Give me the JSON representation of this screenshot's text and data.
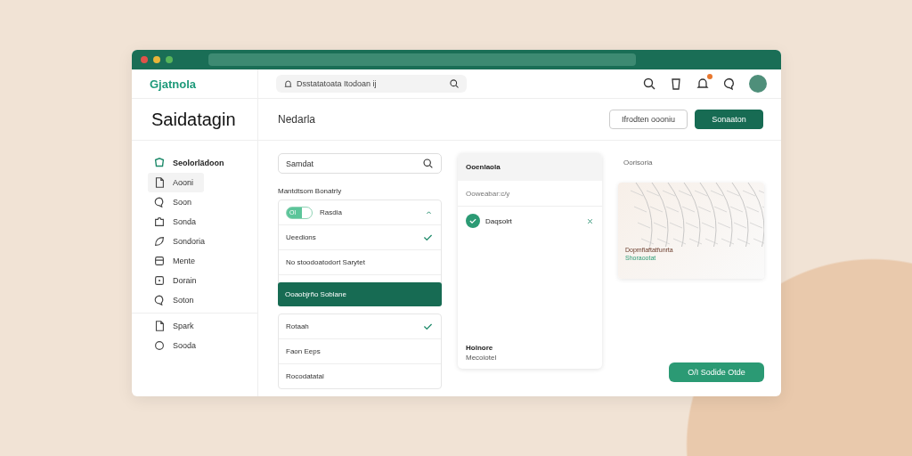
{
  "window": {
    "logo": "Gjatnola",
    "search": {
      "placeholder": "Dsstatatoata Itodoan ij"
    },
    "notifications": true
  },
  "sidebar": {
    "title": "Saidatagin",
    "heading": "Seolorlädoon",
    "items": [
      {
        "label": "Aooni",
        "kind": "doc",
        "selected": true
      },
      {
        "label": "Soon",
        "kind": "chat",
        "selected": false
      },
      {
        "label": "Sonda",
        "kind": "puzzle",
        "selected": false
      },
      {
        "label": "Sondoria",
        "kind": "leaf",
        "selected": false
      },
      {
        "label": "Mente",
        "kind": "box",
        "selected": false
      },
      {
        "label": "Dorain",
        "kind": "square",
        "selected": false
      },
      {
        "label": "Soton",
        "kind": "chat",
        "selected": false
      }
    ],
    "footer_items": [
      {
        "label": "Spark",
        "kind": "doc",
        "selected": false
      },
      {
        "label": "Sooda",
        "kind": "circle",
        "selected": false
      }
    ]
  },
  "header": {
    "title": "Nedarla",
    "buttons": [
      {
        "label": "Ifrodten oooniu",
        "kind": "outline"
      },
      {
        "label": "Sonaaton",
        "kind": "primary"
      }
    ]
  },
  "filters": {
    "search": {
      "value": "Samdat"
    },
    "section_label": "Mantdtsom Bonatrly",
    "groups": [
      {
        "items": [
          {
            "kind": "toggle",
            "label": "Rasdia",
            "toggle_text": "Ol",
            "on": true,
            "expanded": true
          },
          {
            "kind": "row",
            "label": "Ueedions",
            "checked": true
          },
          {
            "kind": "row",
            "label": "No stoodoatodort Sarytet",
            "checked": false
          },
          {
            "kind": "highlight",
            "label": "Ooaobjrño Soblane"
          }
        ]
      },
      {
        "items": [
          {
            "kind": "row",
            "label": "Rotaah",
            "checked": true
          },
          {
            "kind": "row",
            "label": "Faon Eeps",
            "checked": false
          },
          {
            "kind": "row",
            "label": "Rocodatatal",
            "checked": false
          }
        ]
      }
    ]
  },
  "summary": {
    "title": "Ooenlaola",
    "subtitle": "Ooweabar:c/y",
    "entry": {
      "label": "Daqsolrt",
      "checked": true
    },
    "footer_title": "Holnore",
    "footer_text": "Mecoiotel"
  },
  "preview": {
    "label": "Oorisoria",
    "caption": "Dopmfiaftatfunrta",
    "link": "Shoraootat",
    "button": "O/I Sodide Otde"
  }
}
